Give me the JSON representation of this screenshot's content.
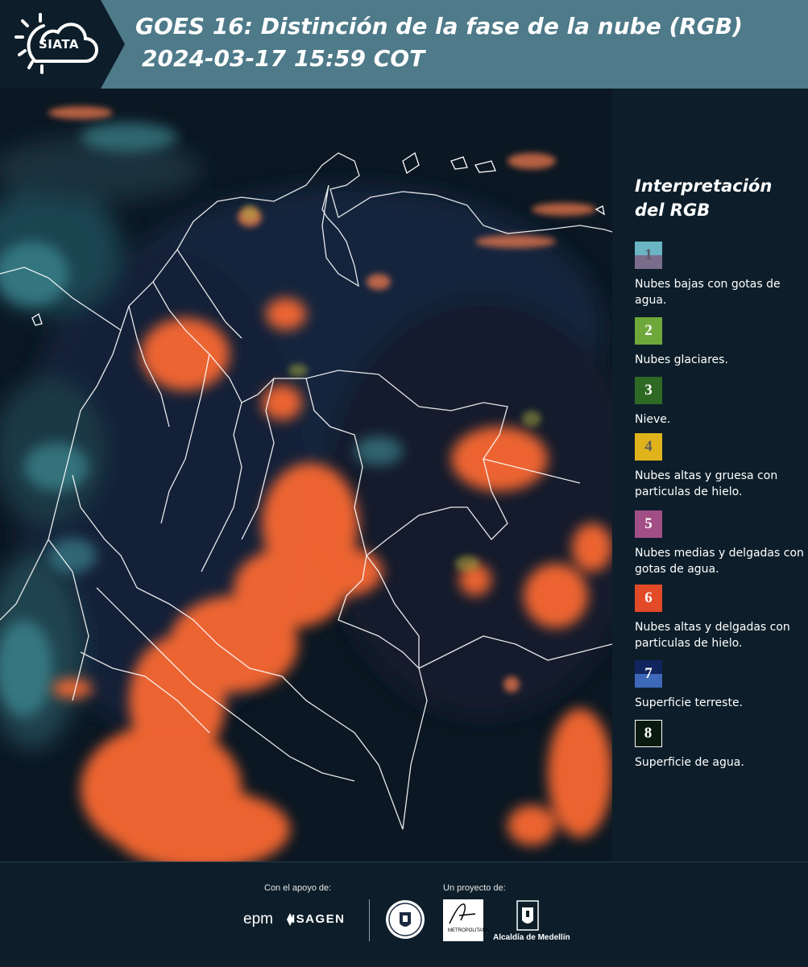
{
  "header": {
    "logo_text": "SIATA",
    "title_line1": "GOES 16: Distinción de la fase de la nube (RGB)",
    "title_line2": "2024-03-17 15:59 COT"
  },
  "legend": {
    "title_line1": "Interpretación",
    "title_line2": "del RGB",
    "items": [
      {
        "num": "1",
        "label": "Nubes bajas con gotas de agua.",
        "color_top": "#6ab4c4",
        "color_bottom": "#7a6d8c",
        "num_color": "#5a5a66"
      },
      {
        "num": "2",
        "label": "Nubes glaciares.",
        "color": "#6ea83a",
        "num_color": "#ffffff"
      },
      {
        "num": "3",
        "label": "Nieve.",
        "color": "#2f6a24",
        "num_color": "#ffffff"
      },
      {
        "num": "4",
        "label": "Nubes altas y gruesa con particulas de hielo.",
        "color": "#e0b31c",
        "num_color": "#5a5a5a"
      },
      {
        "num": "5",
        "label": "Nubes medias y delgadas con gotas de agua.",
        "color": "#a24e86",
        "num_color": "#ffffff"
      },
      {
        "num": "6",
        "label": "Nubes altas y delgadas con particulas de hielo.",
        "color": "#e24a28",
        "num_color": "#ffffff"
      },
      {
        "num": "7",
        "label": "Superficie terreste.",
        "color_top": "#10245e",
        "color_bottom": "#3e68b8",
        "num_color": "#ffffff"
      },
      {
        "num": "8",
        "label": "Superficie de agua.",
        "color": "#0a1a10",
        "num_color": "#ffffff",
        "border": "#ffffff"
      }
    ]
  },
  "footer": {
    "support_label": "Con el apoyo de:",
    "project_label": "Un proyecto de:",
    "sponsor1": "epm",
    "sponsor2": "ISAGEN",
    "area_logo_text": "METROPOLITANA",
    "medellin_label": "Alcaldía de Medellín"
  }
}
